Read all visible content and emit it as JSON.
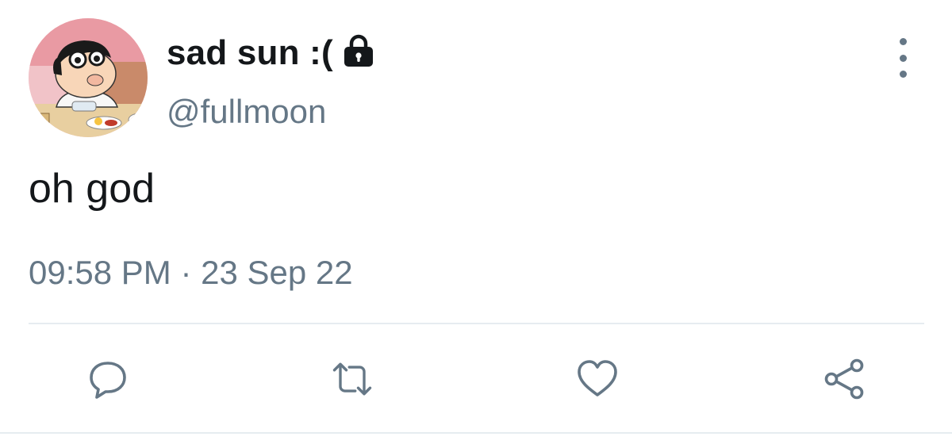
{
  "tweet": {
    "display_name": "sad sun :(",
    "handle": "@fullmoon",
    "text": "oh god",
    "timestamp": "09:58 PM · 23 Sep 22",
    "protected_icon": "lock-icon",
    "avatar_description_icon": "cartoon-avatar"
  },
  "actions": {
    "reply_icon": "comment-icon",
    "retweet_icon": "retweet-icon",
    "like_icon": "heart-icon",
    "share_icon": "share-icon"
  },
  "colors": {
    "text_primary": "#14171a",
    "text_secondary": "#657786",
    "divider": "#e6ecf0"
  }
}
